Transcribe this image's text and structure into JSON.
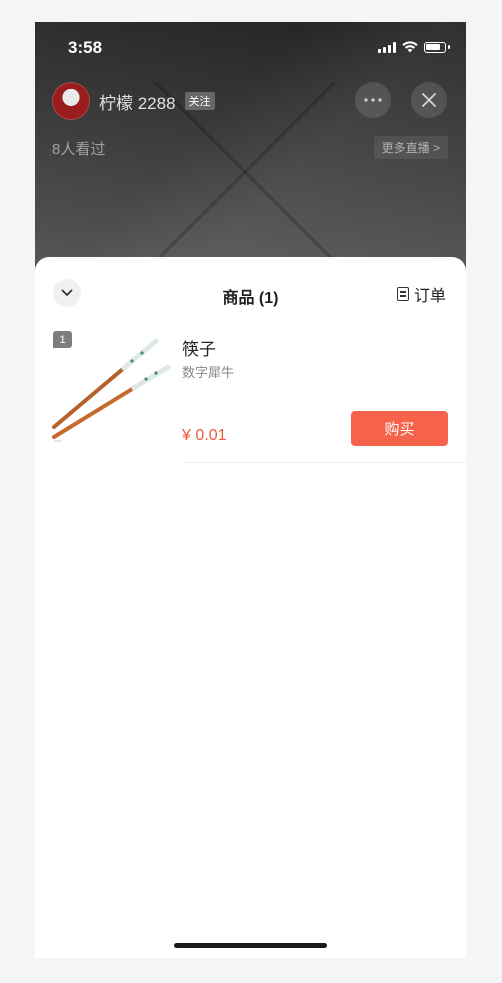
{
  "status_bar": {
    "time": "3:58"
  },
  "live": {
    "streamer_name": "柠檬 2288",
    "follow_label": "关注",
    "viewer_count": "8人看过",
    "more_live": "更多直播 >",
    "more_icon": "ellipsis-icon",
    "close_icon": "close-icon"
  },
  "sheet": {
    "title": "商品 (1)",
    "orders_label": "订单",
    "collapse_icon": "chevron-down-icon",
    "orders_icon": "clipboard-icon"
  },
  "products": [
    {
      "rank": "1",
      "name": "筷子",
      "shop": "数字犀牛",
      "price": "¥ 0.01",
      "buy_label": "购买"
    }
  ],
  "colors": {
    "buy_button": "#f6634b",
    "price": "#f05a3c"
  }
}
